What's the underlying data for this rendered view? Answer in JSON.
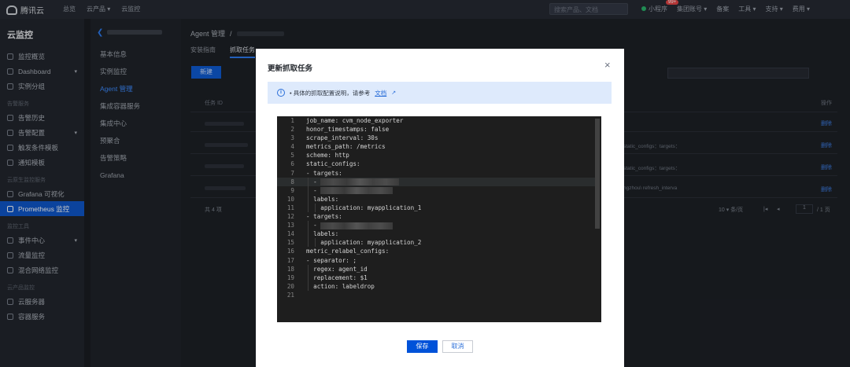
{
  "topbar": {
    "logo": "腾讯云",
    "nav": [
      "总览",
      "云产品 ▾",
      "云监控"
    ],
    "search_placeholder": "搜索产品、文档",
    "right": [
      "小程序",
      "集团账号 ▾",
      "备案",
      "工具 ▾",
      "支持 ▾",
      "费用 ▾"
    ],
    "badge": "99+"
  },
  "sidebar": {
    "title": "云监控",
    "groups": [
      {
        "label": "",
        "items": [
          {
            "label": "监控概览"
          },
          {
            "label": "Dashboard",
            "caret": "▾"
          },
          {
            "label": "实例分组"
          }
        ]
      },
      {
        "label": "告警服务",
        "items": [
          {
            "label": "告警历史"
          },
          {
            "label": "告警配置",
            "caret": "▾"
          },
          {
            "label": "触发条件模板"
          },
          {
            "label": "通知模板"
          }
        ]
      },
      {
        "label": "云原生监控服务",
        "items": [
          {
            "label": "Grafana 可视化"
          },
          {
            "label": "Prometheus 监控",
            "active": true
          }
        ]
      },
      {
        "label": "监控工具",
        "items": [
          {
            "label": "事件中心",
            "caret": "▾"
          },
          {
            "label": "流量监控"
          },
          {
            "label": "混合网络监控"
          }
        ]
      },
      {
        "label": "云产品监控",
        "items": [
          {
            "label": "云服务器"
          },
          {
            "label": "容器服务"
          }
        ]
      }
    ]
  },
  "subnav": {
    "items": [
      {
        "label": "基本信息"
      },
      {
        "label": "实例监控"
      },
      {
        "label": "Agent 管理",
        "active": true
      },
      {
        "label": "集成容器服务"
      },
      {
        "label": "集成中心"
      },
      {
        "label": "预聚合"
      },
      {
        "label": "告警策略"
      },
      {
        "label": "Grafana"
      }
    ]
  },
  "content": {
    "crumb": "Agent 管理",
    "crumb_sep": "/",
    "tabs": [
      "安装指南",
      "抓取任务"
    ],
    "new_button": "新建",
    "col_id": "任务 ID",
    "col_op": "操作",
    "rows": [
      {
        "text": "",
        "op": "删除"
      },
      {
        "text": "static_configs：targets：",
        "op": "删除"
      },
      {
        "text": "static_configs：targets：",
        "op": "删除"
      },
      {
        "text": "ngzhou\\ refresh_interva",
        "op": "删除"
      }
    ],
    "total": "共 4 项",
    "page_size": "10 ▾ 条/页",
    "page_num": "1",
    "page_total": "/ 1 页"
  },
  "modal": {
    "title": "更新抓取任务",
    "close": "×",
    "info_icon": "i",
    "info_text": "• 具体的抓取配置说明，请参考",
    "info_link": "文档",
    "ext_icon": "↗",
    "save": "保存",
    "cancel": "取消",
    "code": [
      {
        "n": "1",
        "indent": 0,
        "text": "job_name: cvm_node_exporter"
      },
      {
        "n": "2",
        "indent": 0,
        "text": "honor_timestamps: false"
      },
      {
        "n": "3",
        "indent": 0,
        "text": "scrape_interval: 30s"
      },
      {
        "n": "4",
        "indent": 0,
        "text": "metrics_path: /metrics"
      },
      {
        "n": "5",
        "indent": 0,
        "text": "scheme: http"
      },
      {
        "n": "6",
        "indent": 0,
        "text": "static_configs:"
      },
      {
        "n": "7",
        "indent": 0,
        "text": "- targets:"
      },
      {
        "n": "8",
        "indent": 1,
        "text": "- ",
        "blur": 100,
        "hl": true
      },
      {
        "n": "9",
        "indent": 1,
        "text": "- ",
        "blur": 92
      },
      {
        "n": "10",
        "indent": 1,
        "text": "labels:"
      },
      {
        "n": "11",
        "indent": 2,
        "text": "application: myapplication_1"
      },
      {
        "n": "12",
        "indent": 0,
        "text": "- targets:"
      },
      {
        "n": "13",
        "indent": 1,
        "text": "- ",
        "blur": 92
      },
      {
        "n": "14",
        "indent": 1,
        "text": "labels:"
      },
      {
        "n": "15",
        "indent": 2,
        "text": "application: myapplication_2"
      },
      {
        "n": "16",
        "indent": 0,
        "text": "metric_relabel_configs:"
      },
      {
        "n": "17",
        "indent": 0,
        "text": "- separator: ;"
      },
      {
        "n": "18",
        "indent": 1,
        "text": "regex: agent_id"
      },
      {
        "n": "19",
        "indent": 1,
        "text": "replacement: $1"
      },
      {
        "n": "20",
        "indent": 1,
        "text": "action: labeldrop"
      },
      {
        "n": "21",
        "indent": 0,
        "text": ""
      }
    ]
  }
}
